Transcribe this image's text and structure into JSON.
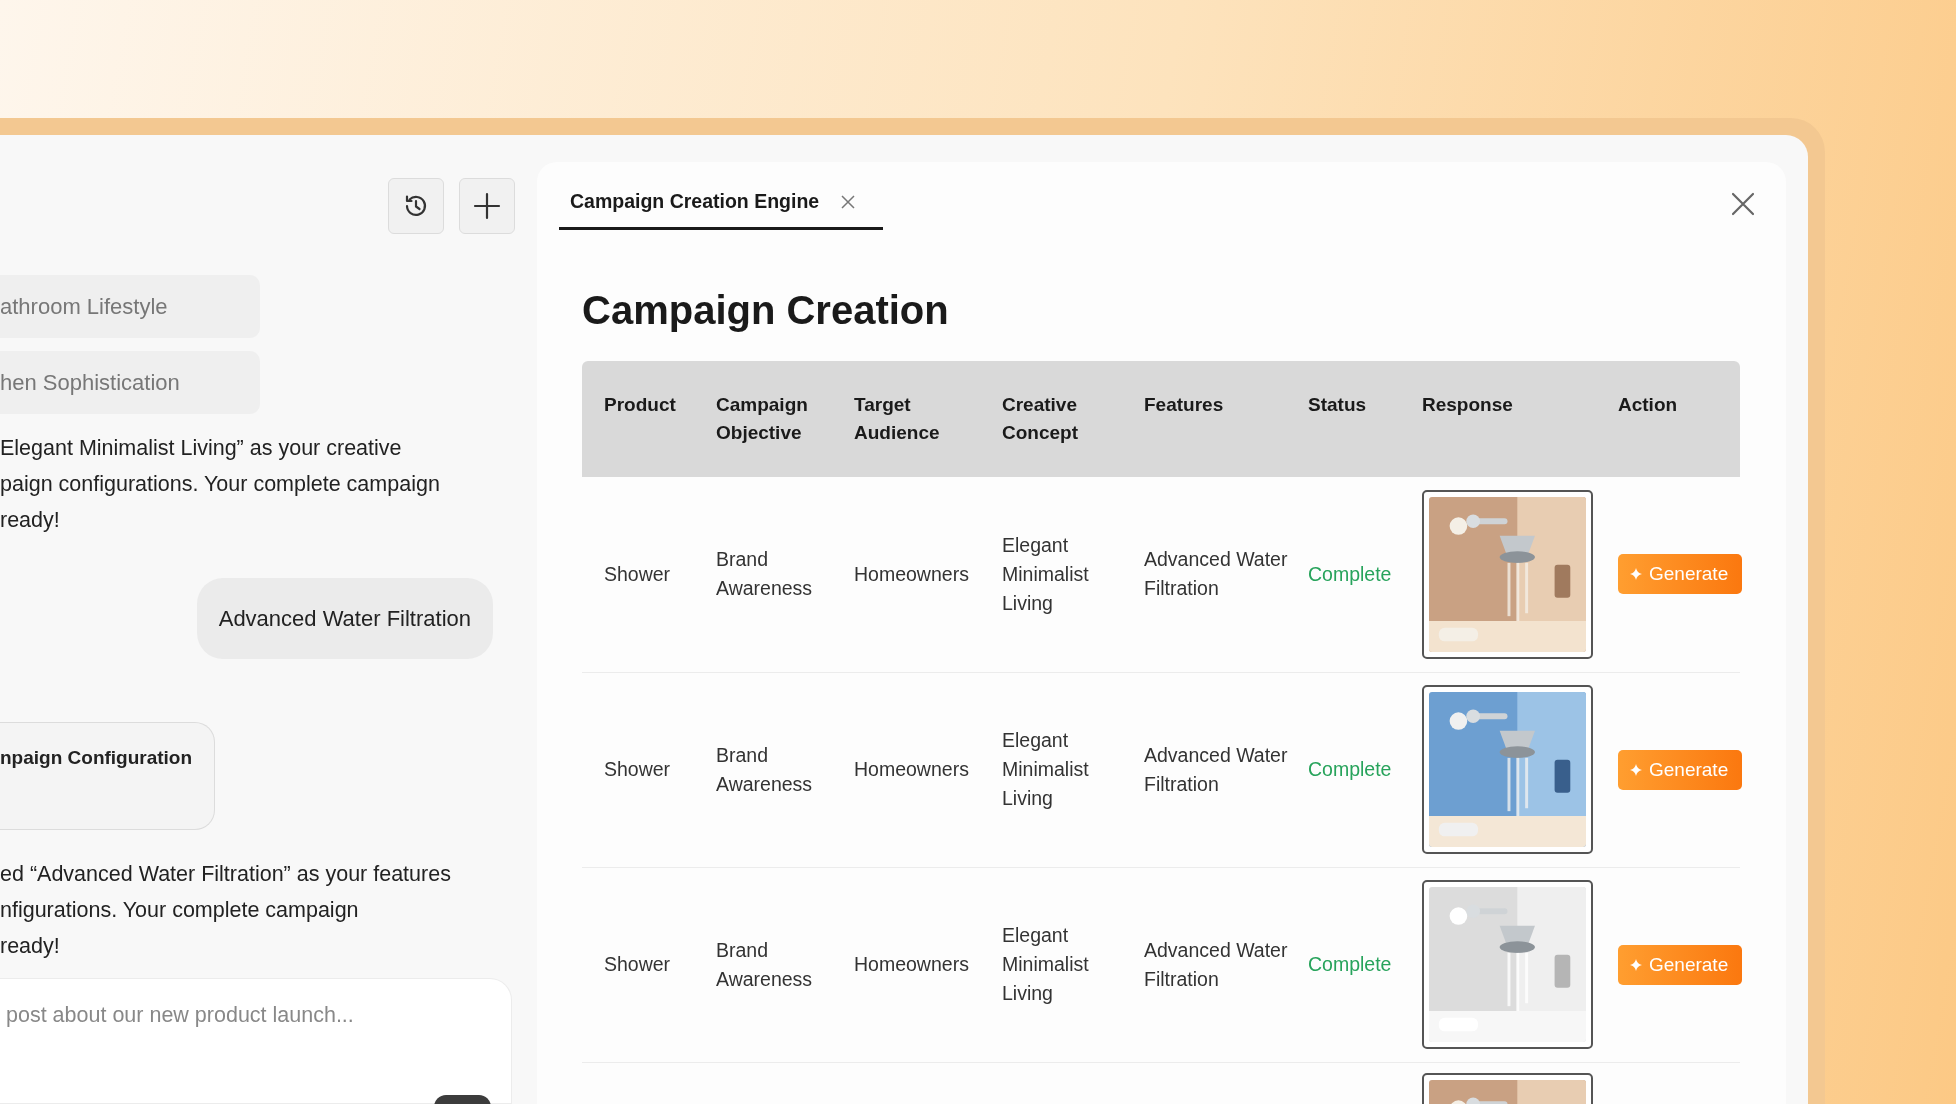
{
  "chat": {
    "options": [
      "athroom Lifestyle",
      "hen Sophistication"
    ],
    "messages": [
      {
        "kind": "assistant",
        "lines": [
          "Elegant Minimalist Living” as your creative",
          "paign configurations. Your complete campaign",
          "ready!"
        ]
      },
      {
        "kind": "user",
        "text": "Advanced Water Filtration"
      },
      {
        "kind": "card",
        "text": "npaign Configuration"
      },
      {
        "kind": "assistant",
        "lines": [
          "ed “Advanced Water Filtration” as your features",
          "nfigurations. Your complete campaign",
          "ready!"
        ]
      }
    ],
    "composer": {
      "placeholder": "post about our new product launch..."
    }
  },
  "panel": {
    "tabs": [
      {
        "label": "Campaign Creation Engine",
        "selected": true
      }
    ],
    "title": "Campaign Creation",
    "table": {
      "columns": [
        "Product",
        "Campaign Objective",
        "Target Audience",
        "Creative Concept",
        "Features",
        "Status",
        "Response",
        "Action"
      ],
      "rows": [
        {
          "product": "Shower",
          "objective": "Brand Awareness",
          "audience": "Homeowners",
          "concept": "Elegant Minimalist Living",
          "features": "Advanced Water Filtration",
          "status": "Complete",
          "complete": true,
          "response": {
            "kind": "picture"
          },
          "action": "Generate"
        },
        {
          "product": "Shower",
          "objective": "Brand Awareness",
          "audience": "Homeowners",
          "concept": "Elegant Minimalist Living",
          "features": "Advanced Water Filtration",
          "status": "Complete",
          "complete": true,
          "response": {
            "kind": "picture"
          },
          "action": "Generate"
        },
        {
          "product": "Shower",
          "objective": "Brand Awareness",
          "audience": "Homeowners",
          "concept": "Elegant Minimalist Living",
          "features": "Advanced Water Filtration",
          "status": "Complete",
          "complete": true,
          "response": {
            "kind": "picture"
          },
          "action": "Generate"
        },
        {
          "response": {
            "kind": "picture"
          }
        }
      ]
    }
  }
}
